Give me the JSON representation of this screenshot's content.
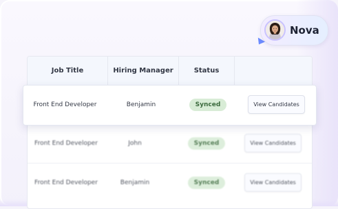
{
  "assistant": {
    "name": "Nova",
    "avatar_icon": "woman-avatar"
  },
  "table": {
    "headers": [
      "Job Title",
      "Hiring Manager",
      "Status"
    ],
    "highlighted_row": {
      "job_title": "Front End Developer",
      "hiring_manager": "Benjamin",
      "status": "Synced",
      "action": "View Candidates"
    },
    "rows": [
      {
        "job_title": "Front End Developer",
        "hiring_manager": "John",
        "status": "Synced",
        "action": "View Candidates"
      },
      {
        "job_title": "Front End Developer",
        "hiring_manager": "Benjamin",
        "status": "Synced",
        "action": "View Candidates"
      }
    ]
  },
  "colors": {
    "status_badge_bg": "#d8ecd6",
    "status_badge_text": "#3b6a3d",
    "header_bg": "#f4f7fd",
    "accent": "#6d8cff"
  }
}
